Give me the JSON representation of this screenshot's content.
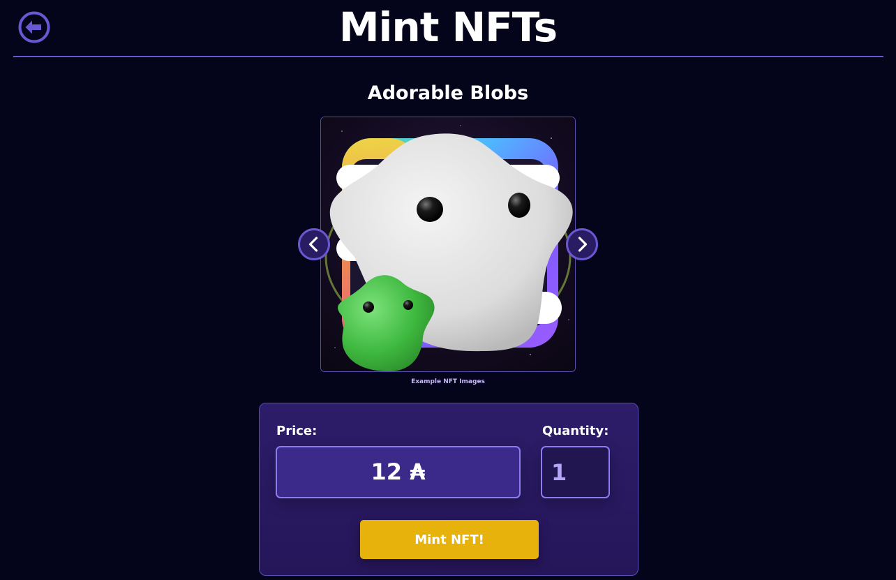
{
  "header": {
    "title": "Mint NFTs",
    "back_icon": "arrow-left-circle-icon"
  },
  "collection": {
    "title": "Adorable Blobs",
    "caption": "Example NFT Images",
    "prev_icon": "chevron-left-icon",
    "next_icon": "chevron-right-icon"
  },
  "mint": {
    "price_label": "Price:",
    "price_value": "12 ₳",
    "quantity_label": "Quantity:",
    "quantity_value": "1",
    "button_label": "Mint NFT!"
  },
  "colors": {
    "background": "#04041a",
    "accent": "#6a58d2",
    "panel": "#2d1d6a",
    "button": "#e8b20c"
  }
}
